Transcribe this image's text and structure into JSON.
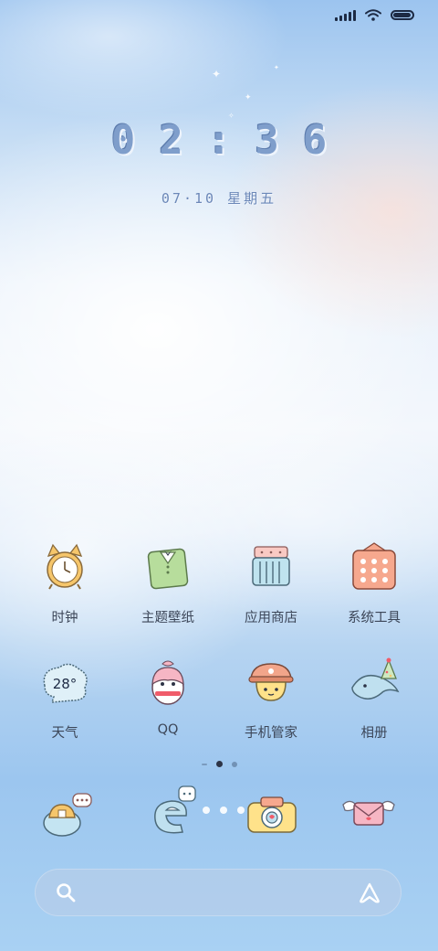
{
  "status_bar": {
    "signal_icon": "signal-bars-icon",
    "wifi_icon": "wifi-icon",
    "battery_icon": "battery-icon",
    "battery_level": 0.95
  },
  "lockscreen_widget": {
    "time": "02:36",
    "date": "07·10 星期五"
  },
  "apps": [
    {
      "label": "时钟",
      "icon": "alarm-clock-icon"
    },
    {
      "label": "主题壁纸",
      "icon": "theme-wallpaper-icon"
    },
    {
      "label": "应用商店",
      "icon": "app-store-icon"
    },
    {
      "label": "系统工具",
      "icon": "system-tools-icon"
    },
    {
      "label": "天气",
      "icon": "weather-icon",
      "badge": "28°"
    },
    {
      "label": "QQ",
      "icon": "penguin-qq-icon"
    },
    {
      "label": "手机管家",
      "icon": "security-manager-icon"
    },
    {
      "label": "相册",
      "icon": "gallery-icon"
    }
  ],
  "page_indicator": {
    "pages": 3,
    "current": 2
  },
  "dock": [
    {
      "icon": "phone-dock-icon"
    },
    {
      "icon": "browser-dock-icon"
    },
    {
      "icon": "camera-dock-icon"
    },
    {
      "icon": "messages-dock-icon"
    }
  ],
  "search_bar": {
    "search_icon": "search-icon",
    "assistant_icon": "assistant-icon"
  },
  "colors": {
    "clock_text": "#7f9ecb",
    "label_text": "#3c4658"
  }
}
